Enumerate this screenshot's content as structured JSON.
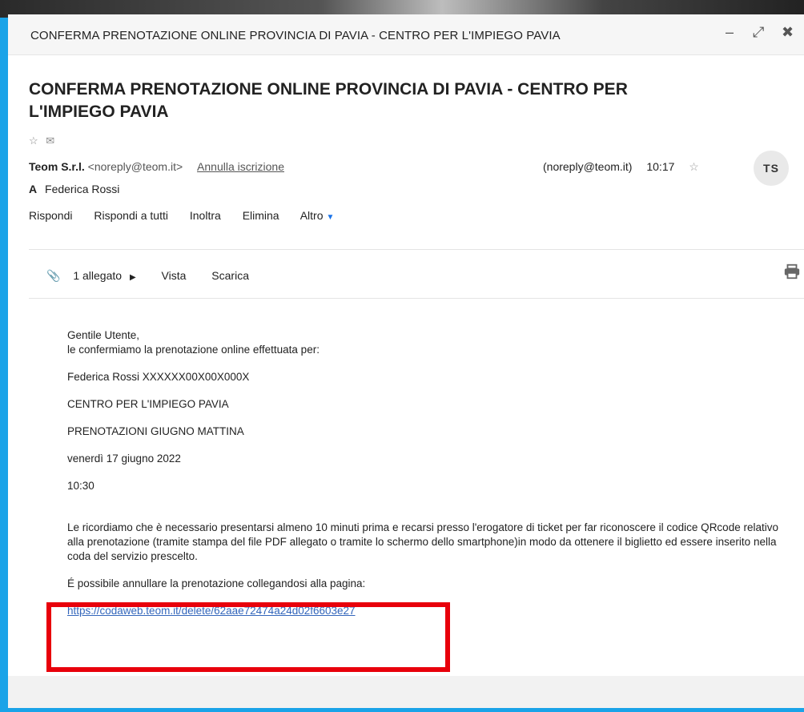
{
  "window": {
    "title": "CONFERMA PRENOTAZIONE ONLINE PROVINCIA DI PAVIA - CENTRO PER L'IMPIEGO PAVIA",
    "controls": {
      "minimize": "‒",
      "maximize": "⤢",
      "close": "✖"
    }
  },
  "email": {
    "subject": "CONFERMA PRENOTAZIONE ONLINE PROVINCIA DI PAVIA - CENTRO PER L'IMPIEGO PAVIA",
    "icons": {
      "star": "☆",
      "envelope": "✉"
    },
    "from_name": "Teom S.r.l.",
    "from_email": "<noreply@teom.it>",
    "unsubscribe": "Annulla iscrizione",
    "reply_to": "(noreply@teom.it)",
    "time": "10:17",
    "star_icon": "☆",
    "avatar": "TS",
    "to_label": "A",
    "to_name": "Federica Rossi"
  },
  "actions": {
    "reply": "Rispondi",
    "reply_all": "Rispondi a tutti",
    "forward": "Inoltra",
    "delete": "Elimina",
    "more": "Altro"
  },
  "attachments": {
    "count": "1 allegato",
    "view": "Vista",
    "download": "Scarica"
  },
  "body": {
    "greeting": "Gentile Utente,",
    "intro": "le confermiamo la prenotazione online effettuata per:",
    "person": "Federica Rossi XXXXXX00X00X000X",
    "office": "CENTRO PER L'IMPIEGO PAVIA",
    "service": "PRENOTAZIONI GIUGNO MATTINA",
    "date": "venerdì 17 giugno 2022",
    "time": "10:30",
    "notice": "Le ricordiamo che è necessario presentarsi almeno 10 minuti prima e recarsi presso l'erogatore di ticket per far riconoscere il codice QRcode relativo alla prenotazione (tramite stampa del file PDF allegato o tramite lo schermo dello smartphone)in modo da ottenere il biglietto ed essere inserito nella coda del servizio prescelto.",
    "cancel_text": "É possibile annullare la prenotazione collegandosi alla pagina:",
    "cancel_link": "https://codaweb.teom.it/delete/62aae72474a24d02f6603e27"
  },
  "colors": {
    "frame": "#1aa3e8",
    "highlight": "#e8000b",
    "link": "#3366bb"
  }
}
